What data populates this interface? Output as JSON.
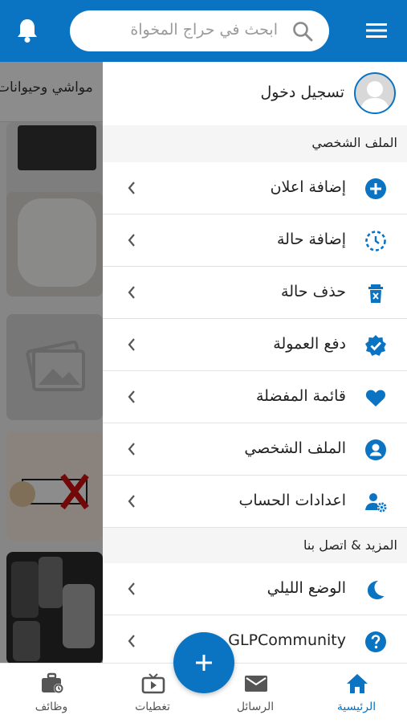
{
  "colors": {
    "primary": "#0a73c2",
    "text": "#222222",
    "muted": "#9a9a9a"
  },
  "header": {
    "search_placeholder": "ابحث في حراج المخواة",
    "menu_icon": "hamburger-menu-icon",
    "notification_icon": "bell-icon"
  },
  "background": {
    "category_label": "مواشي وحيوانات"
  },
  "drawer": {
    "login_label": "تسجيل دخول",
    "sections": [
      {
        "title": "الملف الشخصي"
      },
      {
        "title": "المزيد & اتصل بنا"
      }
    ],
    "items": [
      {
        "label": "إضافة اعلان",
        "icon": "add-circle-icon"
      },
      {
        "label": "إضافة حالة",
        "icon": "clock-dashed-icon"
      },
      {
        "label": "حذف حالة",
        "icon": "delete-icon"
      },
      {
        "label": "دفع العمولة",
        "icon": "verified-badge-icon"
      },
      {
        "label": "قائمة المفضلة",
        "icon": "heart-icon"
      },
      {
        "label": "الملف الشخصي",
        "icon": "account-circle-icon"
      },
      {
        "label": "اعدادات الحساب",
        "icon": "user-settings-icon"
      },
      {
        "label": "الوضع الليلي",
        "icon": "moon-icon"
      },
      {
        "label": "GLPCommunity",
        "icon": "help-icon"
      }
    ]
  },
  "bottom_nav": {
    "tabs": [
      {
        "label": "وظائف",
        "icon": "briefcase-icon"
      },
      {
        "label": "تغطيات",
        "icon": "tv-icon"
      },
      {
        "label": "الرسائل",
        "icon": "mail-icon"
      },
      {
        "label": "الرئيسية",
        "icon": "home-icon"
      }
    ],
    "fab_icon": "plus-icon"
  }
}
